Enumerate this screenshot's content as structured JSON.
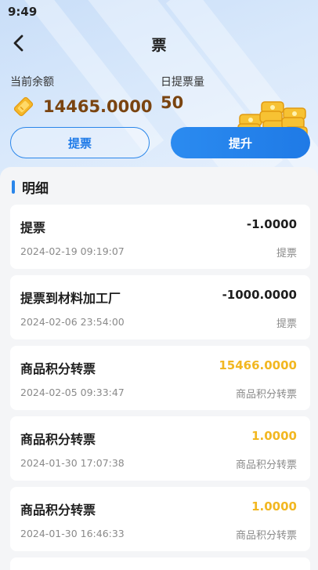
{
  "status_bar": {
    "time": "9:49"
  },
  "header": {
    "title": "票"
  },
  "summary": {
    "balance_label": "当前余额",
    "balance_value": "14465.0000",
    "daily_label": "日提票量",
    "daily_value": "50"
  },
  "actions": {
    "withdraw_label": "提票",
    "upgrade_label": "提升"
  },
  "details": {
    "title": "明细",
    "records": [
      {
        "title": "提票",
        "amount": "-1.0000",
        "time": "2024-02-19 09:19:07",
        "type": "提票",
        "positive": false
      },
      {
        "title": "提票到材料加工厂",
        "amount": "-1000.0000",
        "time": "2024-02-06 23:54:00",
        "type": "提票",
        "positive": false
      },
      {
        "title": "商品积分转票",
        "amount": "15466.0000",
        "time": "2024-02-05 09:33:47",
        "type": "商品积分转票",
        "positive": true
      },
      {
        "title": "商品积分转票",
        "amount": "1.0000",
        "time": "2024-01-30 17:07:38",
        "type": "商品积分转票",
        "positive": true
      },
      {
        "title": "商品积分转票",
        "amount": "1.0000",
        "time": "2024-01-30 16:46:33",
        "type": "商品积分转票",
        "positive": true
      }
    ]
  },
  "colors": {
    "accent": "#2a86ea",
    "positive": "#f2b721",
    "balance": "#7a4410"
  },
  "icons": {
    "back": "chevron-left-icon",
    "ticket": "ticket-icon",
    "coins": "coin-stack-icon"
  }
}
